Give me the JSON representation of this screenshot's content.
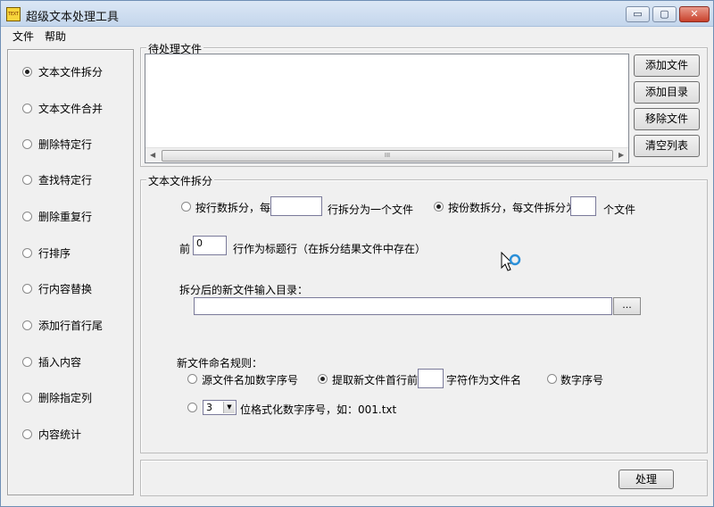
{
  "window": {
    "title": "超级文本处理工具",
    "icon_text": "TEXT",
    "controls": {
      "minimize": "▭",
      "maximize": "▢",
      "close": "✕"
    }
  },
  "menu": {
    "file": "文件",
    "help": "帮助"
  },
  "sidebar": {
    "items": [
      {
        "label": "文本文件拆分",
        "checked": true
      },
      {
        "label": "文本文件合并",
        "checked": false
      },
      {
        "label": "删除特定行",
        "checked": false
      },
      {
        "label": "查找特定行",
        "checked": false
      },
      {
        "label": "删除重复行",
        "checked": false
      },
      {
        "label": "行排序",
        "checked": false
      },
      {
        "label": "行内容替换",
        "checked": false
      },
      {
        "label": "添加行首行尾",
        "checked": false
      },
      {
        "label": "插入内容",
        "checked": false
      },
      {
        "label": "删除指定列",
        "checked": false
      },
      {
        "label": "内容统计",
        "checked": false
      }
    ]
  },
  "file_group": {
    "title": "待处理文件",
    "scroll_thumb_grip": "III",
    "buttons": {
      "add_file": "添加文件",
      "add_dir": "添加目录",
      "remove_file": "移除文件",
      "clear_list": "清空列表"
    }
  },
  "split_group": {
    "title": "文本文件拆分",
    "by_lines": {
      "label_before": "按行数拆分，每",
      "value": "",
      "label_after": "行拆分为一个文件",
      "checked": false
    },
    "by_count": {
      "label_before": "按份数拆分，每文件拆分为",
      "value": "",
      "label_after": "个文件",
      "checked": true
    },
    "header": {
      "label_before": "前",
      "value": "0",
      "label_after": "行作为标题行（在拆分结果文件中存在）"
    },
    "output_dir": {
      "label": "拆分后的新文件输入目录：",
      "value": "",
      "browse": "..."
    },
    "naming": {
      "label": "新文件命名规则：",
      "source_plus_seq": {
        "label": "源文件名加数字序号",
        "checked": false
      },
      "extract_first_line": {
        "label_before": "提取新文件首行前",
        "value": "",
        "label_after": "字符作为文件名",
        "checked": true
      },
      "numeric_seq": {
        "label": "数字序号",
        "checked": false
      },
      "formatted_seq": {
        "value": "3",
        "label": "位格式化数字序号，如：001.txt",
        "checked": false
      }
    }
  },
  "process_button": "处理"
}
